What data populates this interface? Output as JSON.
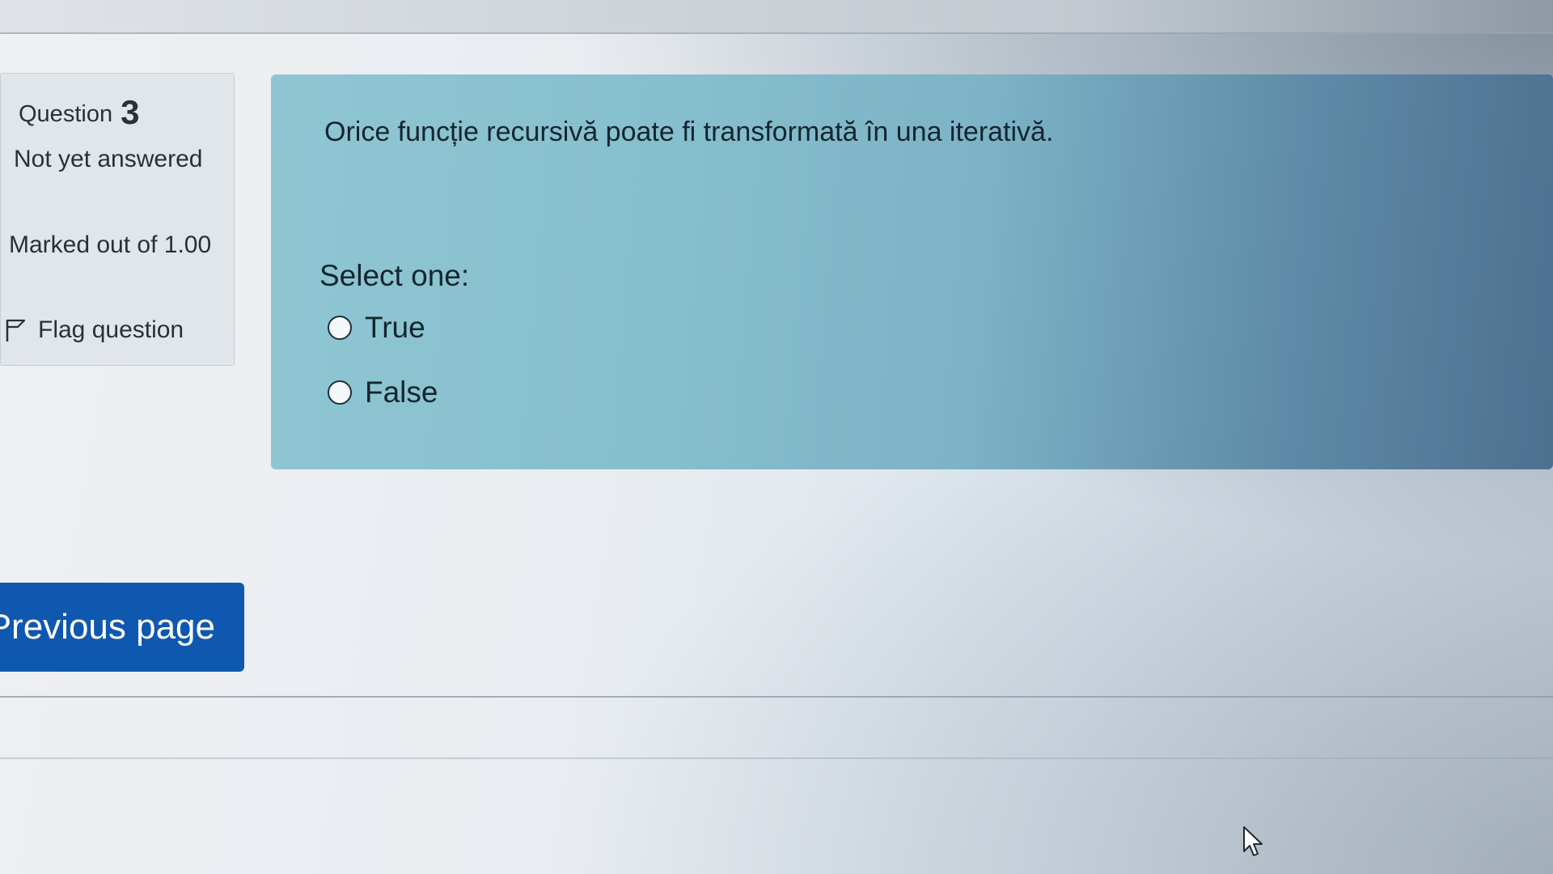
{
  "question": {
    "label": "Question",
    "number": "3",
    "state": "Not yet answered",
    "grade": "Marked out of 1.00",
    "flag_label": "Flag question",
    "text": "Orice funcție recursivă poate fi transformată în una iterativă.",
    "prompt": "Select one:",
    "options": [
      {
        "label": "True",
        "selected": false
      },
      {
        "label": "False",
        "selected": false
      }
    ]
  },
  "navigation": {
    "previous_label": "Previous page"
  },
  "colors": {
    "content_background": "#8fc6d3",
    "info_background": "#e1e6ea",
    "button_primary": "#0f58b0"
  },
  "icons": {
    "flag": "flag-icon",
    "radio": "radio-button",
    "cursor": "mouse-pointer-icon"
  }
}
